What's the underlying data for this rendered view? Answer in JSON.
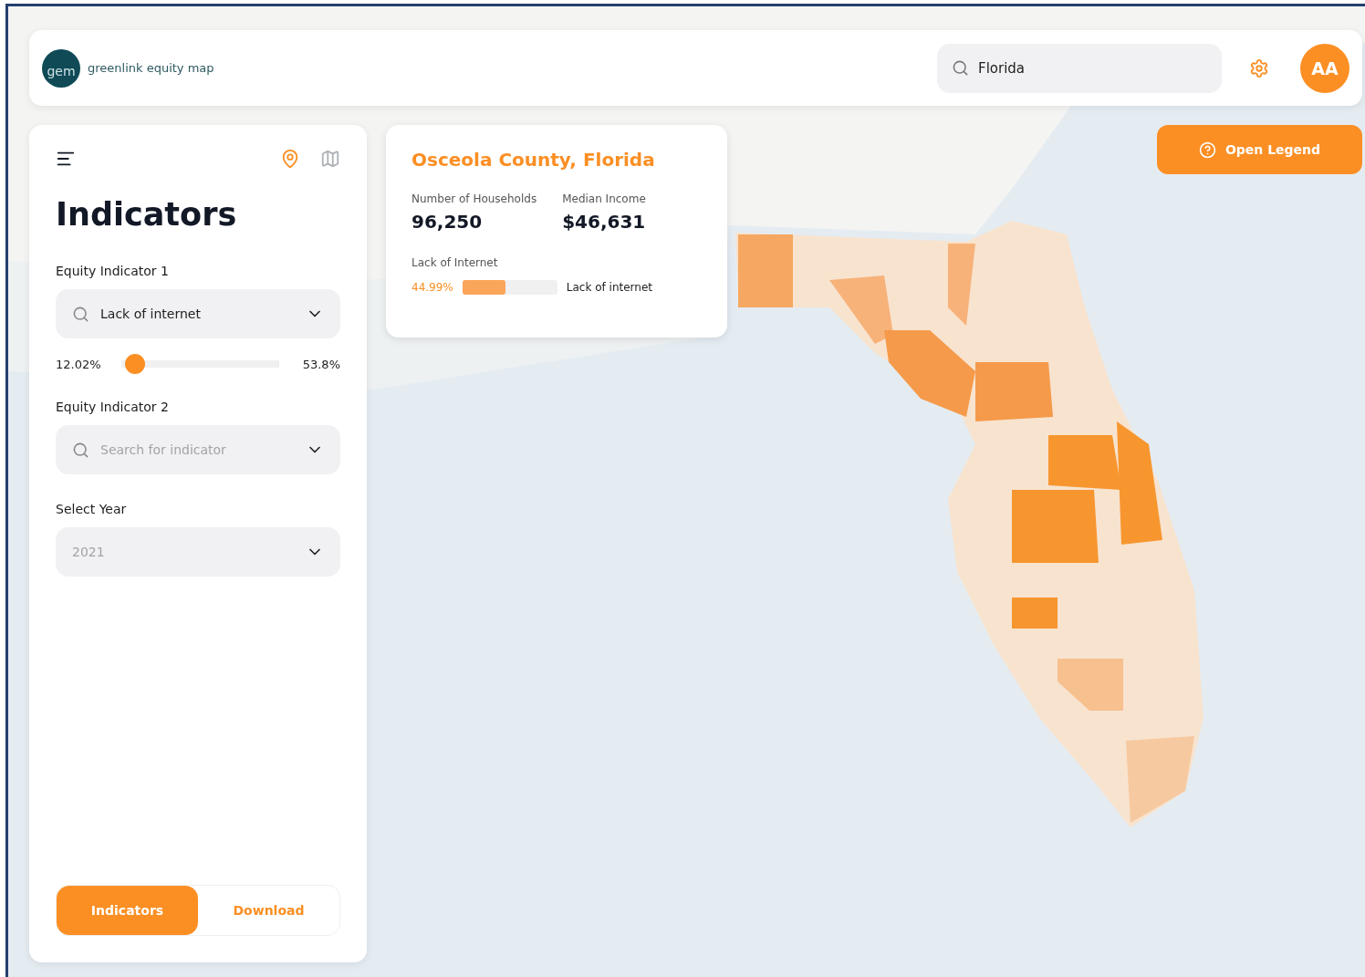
{
  "header": {
    "logo_mark": "gem",
    "logo_text": "greenlink equity map",
    "search": {
      "value": "Florida"
    },
    "avatar": "AA"
  },
  "legend_button": "Open Legend",
  "panel": {
    "view_icons": [
      {
        "kind": "pin",
        "selected": true
      },
      {
        "kind": "map",
        "selected": false
      }
    ],
    "title": "Indicators",
    "indicator_1": {
      "label": "Equity Indicator 1",
      "value": "Lack of internet",
      "range": {
        "min": "12.02%",
        "max": "53.8%",
        "level": 0.03
      }
    },
    "indicator_2": {
      "label": "Equity Indicator 2",
      "placeholder": "Search for indicator"
    },
    "year": {
      "label": "Select Year",
      "placeholder": "2021"
    },
    "tabs": [
      {
        "label": "Indicators",
        "selected": true
      },
      {
        "label": "Download",
        "selected": false
      }
    ]
  },
  "info_card": {
    "title": "Osceola County, Florida",
    "stats": [
      {
        "label": "Number of Households",
        "value": "96,250"
      },
      {
        "label": "Median Income",
        "value": "$46,631"
      }
    ],
    "bar": {
      "label": "Lack of Internet",
      "reading": "44.99%",
      "level": 0.45,
      "name": "Lack of internet"
    }
  }
}
